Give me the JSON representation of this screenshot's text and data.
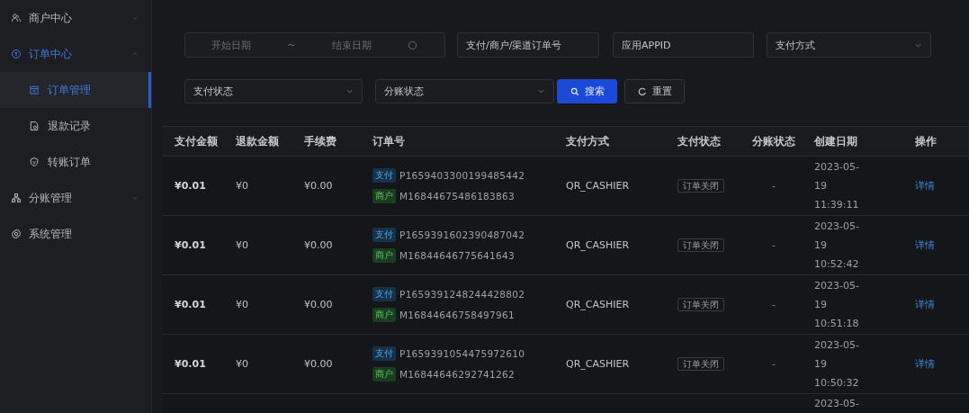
{
  "sidebar": {
    "items": [
      {
        "label": "商户中心",
        "expanded": false,
        "selected": false
      },
      {
        "label": "订单中心",
        "expanded": true,
        "selected": true,
        "children": [
          {
            "label": "订单管理",
            "selected": true
          },
          {
            "label": "退款记录",
            "selected": false
          },
          {
            "label": "转账订单",
            "selected": false
          }
        ]
      },
      {
        "label": "分账管理",
        "expanded": false,
        "selected": false
      },
      {
        "label": "系统管理",
        "selected": false
      }
    ]
  },
  "filters": [
    {
      "kind": "daterange",
      "start_placeholder": "开始日期",
      "separator": "~",
      "end_placeholder": "结束日期"
    },
    {
      "kind": "input",
      "placeholder": "支付/商户/渠道订单号"
    },
    {
      "kind": "input",
      "placeholder": "应用APPID"
    },
    {
      "kind": "select",
      "placeholder": "支付方式"
    },
    {
      "kind": "select",
      "placeholder": "支付状态"
    },
    {
      "kind": "select",
      "placeholder": "分账状态"
    }
  ],
  "buttons": [
    {
      "label": "搜索",
      "kind": "primary"
    },
    {
      "label": "重置",
      "kind": "default"
    }
  ],
  "table": {
    "columns": [
      "支付金额",
      "退款金额",
      "手续费",
      "订单号",
      "支付方式",
      "支付状态",
      "分账状态",
      "创建日期",
      "操作"
    ],
    "rows": [
      {
        "amount": "¥0.01",
        "refund": "¥0",
        "fee": "¥0.00",
        "pay_tag": "支付",
        "pay_no": "P1659403300199485442",
        "mch_tag": "商户",
        "mch_no": "M16844675486183863",
        "method": "QR_CASHIER",
        "status": "订单关闭",
        "split": "-",
        "date": [
          "2023-05-",
          "19",
          "11:39:11"
        ],
        "action": "详情"
      },
      {
        "amount": "¥0.01",
        "refund": "¥0",
        "fee": "¥0.00",
        "pay_tag": "支付",
        "pay_no": "P1659391602390487042",
        "mch_tag": "商户",
        "mch_no": "M16844646775641643",
        "method": "QR_CASHIER",
        "status": "订单关闭",
        "split": "-",
        "date": [
          "2023-05-",
          "19",
          "10:52:42"
        ],
        "action": "详情"
      },
      {
        "amount": "¥0.01",
        "refund": "¥0",
        "fee": "¥0.00",
        "pay_tag": "支付",
        "pay_no": "P1659391248244428802",
        "mch_tag": "商户",
        "mch_no": "M16844646758497961",
        "method": "QR_CASHIER",
        "status": "订单关闭",
        "split": "-",
        "date": [
          "2023-05-",
          "19",
          "10:51:18"
        ],
        "action": "详情"
      },
      {
        "amount": "¥0.01",
        "refund": "¥0",
        "fee": "¥0.00",
        "pay_tag": "支付",
        "pay_no": "P1659391054475972610",
        "mch_tag": "商户",
        "mch_no": "M16844646292741262",
        "method": "QR_CASHIER",
        "status": "订单关闭",
        "split": "-",
        "date": [
          "2023-05-",
          "19",
          "10:50:32"
        ],
        "action": "详情"
      },
      {
        "date": [
          "2023-05-"
        ]
      }
    ]
  }
}
